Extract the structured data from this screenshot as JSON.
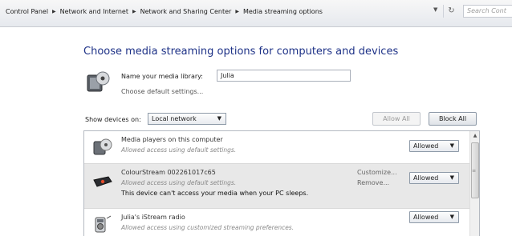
{
  "address_bar": {
    "breadcrumbs": [
      "Control Panel",
      "Network and Internet",
      "Network and Sharing Center",
      "Media streaming options"
    ],
    "search_placeholder": "Search Cont"
  },
  "page": {
    "title": "Choose media streaming options for computers and devices"
  },
  "library": {
    "label": "Name your media library:",
    "value": "Julia",
    "default_link": "Choose default settings..."
  },
  "show_devices": {
    "label": "Show devices on:",
    "selected": "Local network"
  },
  "buttons": {
    "allow_all": "Allow All",
    "block_all": "Block All"
  },
  "devices": [
    {
      "name": "Media players on this computer",
      "subtitle": "Allowed access using default settings.",
      "status": "Allowed",
      "icon": "media-player-icon"
    },
    {
      "name": "ColourStream 002261017c65",
      "subtitle": "Allowed access using default settings.",
      "warning": "This device can't access your media when your PC sleeps.",
      "customize": "Customize...",
      "remove": "Remove...",
      "status": "Allowed",
      "icon": "stream-device-icon"
    },
    {
      "name": "Julia's iStream radio",
      "subtitle": "Allowed access using customized streaming preferences.",
      "status": "Allowed",
      "icon": "radio-icon"
    }
  ],
  "colors": {
    "title_blue": "#1e3287",
    "selected_row": "#e8e8e8"
  }
}
